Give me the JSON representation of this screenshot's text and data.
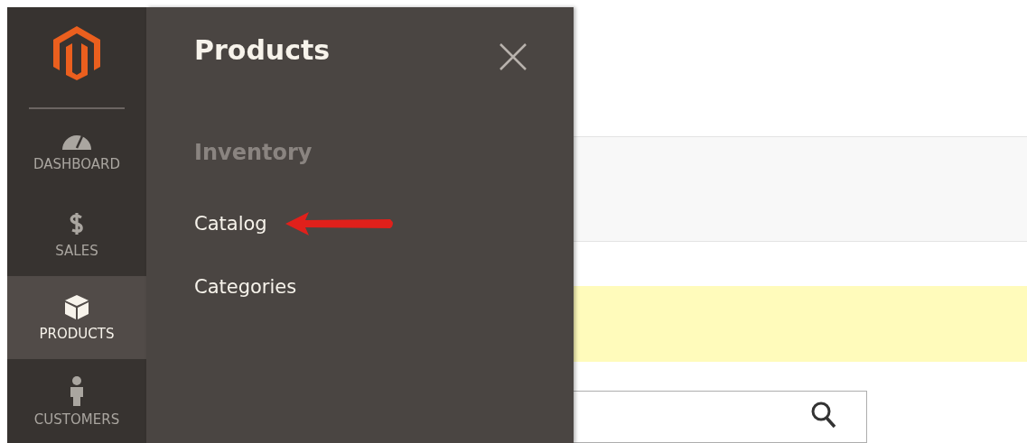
{
  "sidebar": {
    "items": [
      {
        "label": "DASHBOARD",
        "kind": "gauge",
        "selected": false
      },
      {
        "label": "SALES",
        "kind": "dollar",
        "selected": false
      },
      {
        "label": "PRODUCTS",
        "kind": "box",
        "selected": true
      },
      {
        "label": "CUSTOMERS",
        "kind": "person",
        "selected": false
      }
    ]
  },
  "flyout": {
    "title": "Products",
    "section": "Inventory",
    "links": [
      {
        "label": "Catalog",
        "highlighted": true
      },
      {
        "label": "Categories",
        "highlighted": false
      }
    ]
  }
}
